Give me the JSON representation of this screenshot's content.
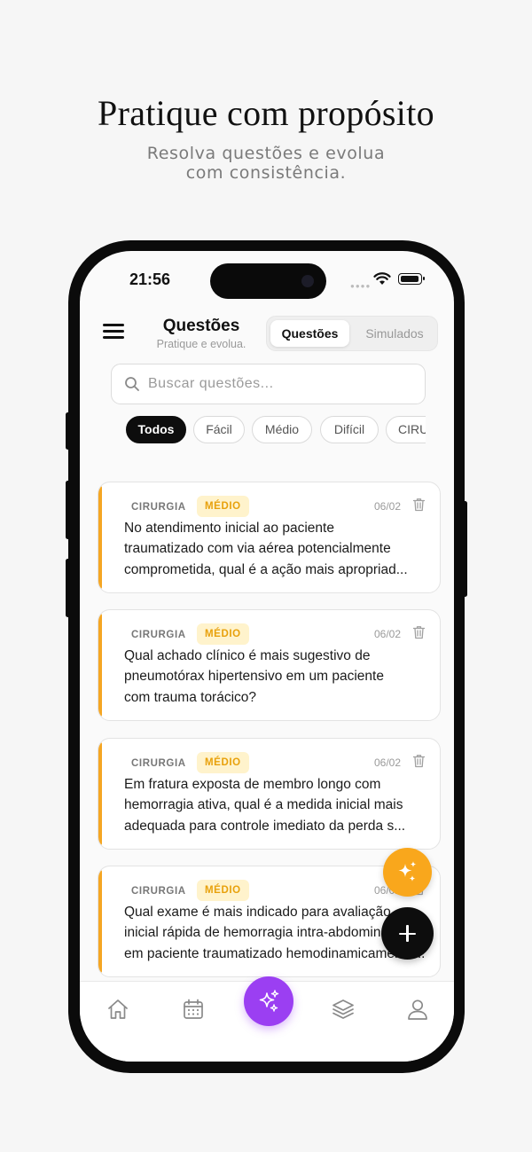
{
  "hero": {
    "title": "Pratique com propósito",
    "subtitle_line1": "Resolva questões e evolua",
    "subtitle_line2": "com consistência."
  },
  "status_bar": {
    "time": "21:56"
  },
  "header": {
    "title": "Questões",
    "subtitle": "Pratique e evolua.",
    "segments": [
      {
        "label": "Questões",
        "selected": true
      },
      {
        "label": "Simulados",
        "selected": false
      }
    ]
  },
  "search": {
    "placeholder": "Buscar questões..."
  },
  "filters": [
    {
      "label": "Todos",
      "selected": true
    },
    {
      "label": "Fácil",
      "selected": false
    },
    {
      "label": "Médio",
      "selected": false
    },
    {
      "label": "Difícil",
      "selected": false
    },
    {
      "label": "CIRU",
      "selected": false
    }
  ],
  "questions": [
    {
      "category": "CIRURGIA",
      "difficulty": "MÉDIO",
      "date": "06/02",
      "lines": [
        "No atendimento inicial ao paciente",
        "traumatizado com via aérea potencialmente",
        "comprometida, qual é a ação mais apropriad..."
      ]
    },
    {
      "category": "CIRURGIA",
      "difficulty": "MÉDIO",
      "date": "06/02",
      "lines": [
        "Qual achado clínico é mais sugestivo de",
        "pneumotórax hipertensivo em um paciente",
        "com trauma torácico?"
      ]
    },
    {
      "category": "CIRURGIA",
      "difficulty": "MÉDIO",
      "date": "06/02",
      "lines": [
        "Em fratura exposta de membro longo com",
        "hemorragia ativa, qual é a medida inicial mais",
        "adequada para controle imediato da perda s..."
      ]
    },
    {
      "category": "CIRURGIA",
      "difficulty": "MÉDIO",
      "date": "06/02",
      "lines": [
        "Qual exame é mais indicado para avaliação",
        "inicial rápida de hemorragia intra-abdominal",
        "em paciente traumatizado hemodinamicamente..."
      ]
    }
  ],
  "tabbar": {
    "items": [
      "home-icon",
      "calendar-icon",
      "sparkles-icon",
      "layers-icon",
      "profile-icon"
    ]
  },
  "colors": {
    "accent_orange": "#f5a623",
    "badge_bg": "#fff3cc",
    "center_tab": "#9b3ff2",
    "fab_ai": "#f9a71c"
  }
}
